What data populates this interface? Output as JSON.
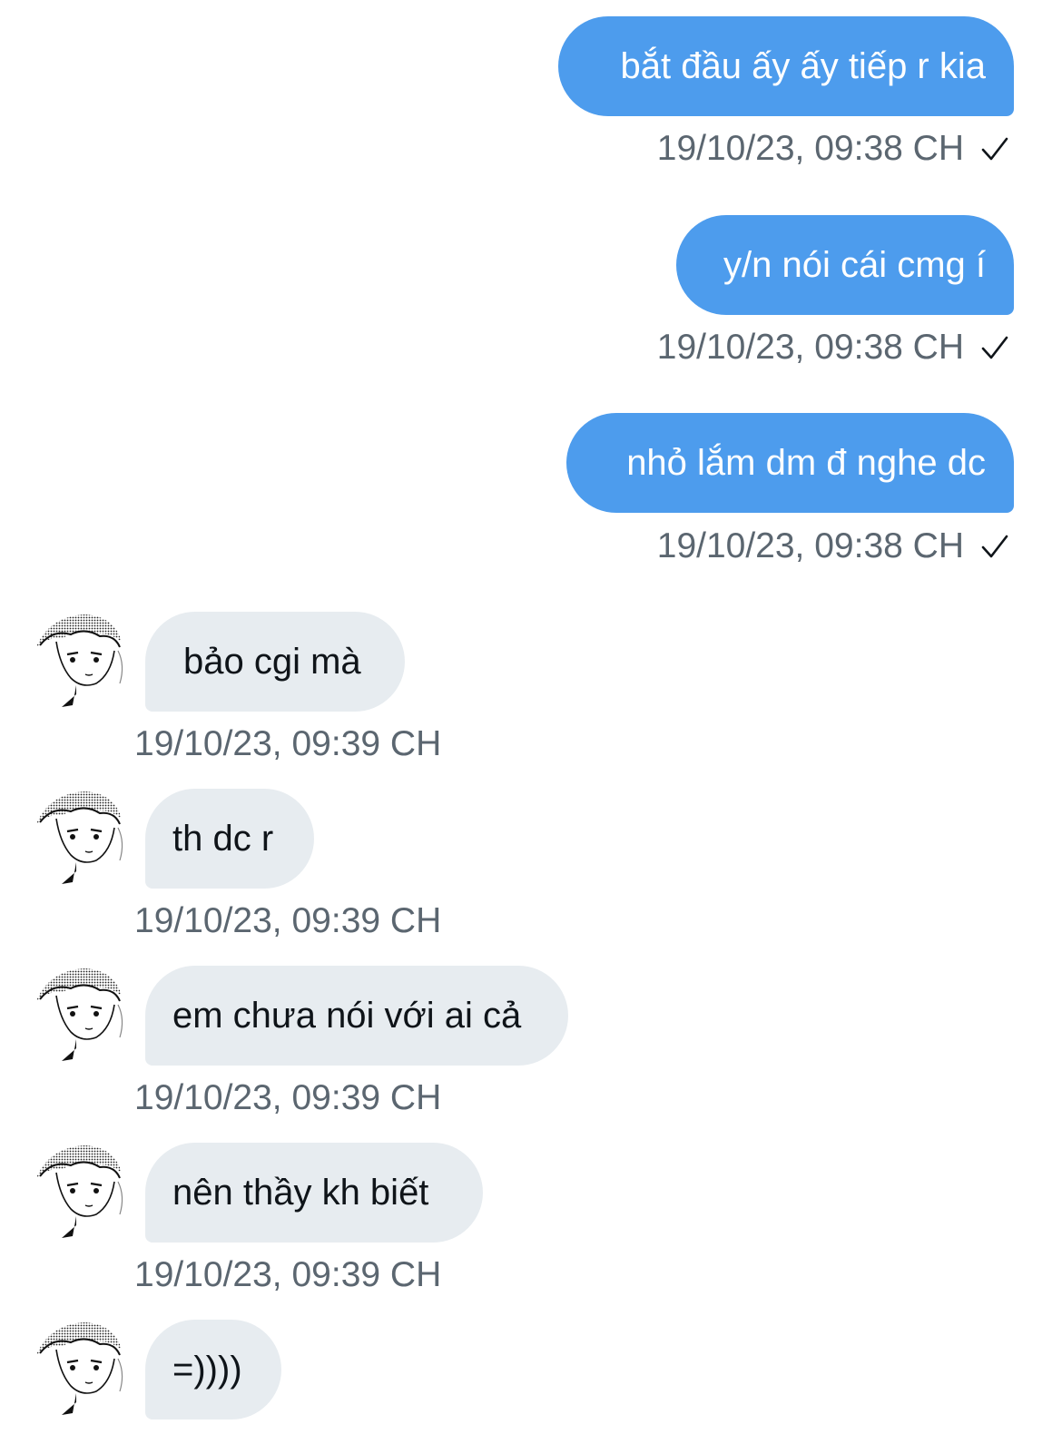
{
  "conversation": {
    "sent": [
      {
        "text": "bắt đầu ấy ấy tiếp r kia",
        "time": "19/10/23, 09:38 CH"
      },
      {
        "text": "y/n nói cái cmg í",
        "time": "19/10/23, 09:38 CH"
      },
      {
        "text": "nhỏ lắm dm đ nghe dc",
        "time": "19/10/23, 09:38 CH"
      }
    ],
    "received": [
      {
        "text": "bảo cgi mà",
        "time": "19/10/23, 09:39 CH"
      },
      {
        "text": "th dc r",
        "time": "19/10/23, 09:39 CH"
      },
      {
        "text": "em chưa nói với ai cả",
        "time": "19/10/23, 09:39 CH"
      },
      {
        "text": "nên thầy kh biết",
        "time": "19/10/23, 09:39 CH"
      },
      {
        "text": "=))))"
      }
    ]
  },
  "icons": {
    "read_receipt": "checkmark-icon",
    "avatar": "anime-avatar-icon"
  },
  "colors": {
    "sent_bubble": "#4d9ced",
    "received_bubble": "#e7ecf0",
    "timestamp": "#5b6670",
    "background": "#ffffff"
  }
}
